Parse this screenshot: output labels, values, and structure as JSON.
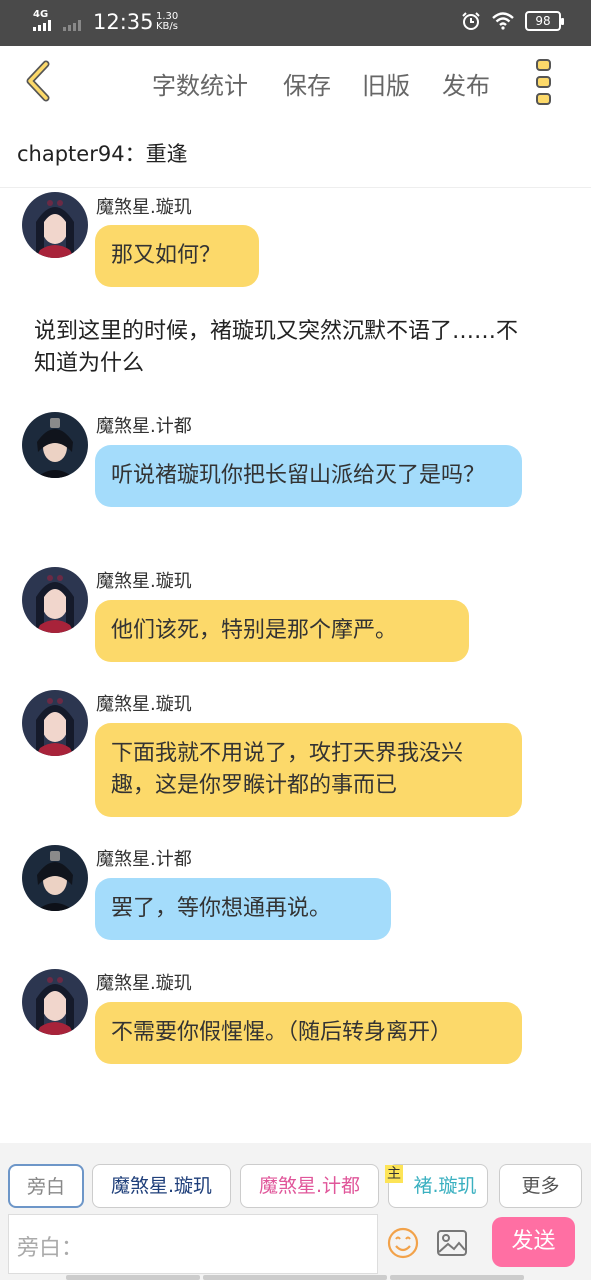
{
  "status_bar": {
    "network": "4G",
    "time": "12:35",
    "speed_value": "1.30",
    "speed_unit": "KB/s",
    "battery": "98"
  },
  "toolbar": {
    "word_count_label": "字数统计",
    "save_label": "保存",
    "old_version_label": "旧版",
    "publish_label": "发布"
  },
  "chapter_title": "chapter94：重逢",
  "messages": [
    {
      "speaker": "魔煞星.璇玑",
      "text": "那又如何？",
      "color": "#fcd96a"
    },
    {
      "speaker": "魔煞星.计都",
      "text": "听说褚璇玑你把长留山派给灭了是吗？",
      "color": "#a4dcfb"
    },
    {
      "speaker": "魔煞星.璇玑",
      "text": "他们该死，特别是那个摩严。",
      "color": "#fcd96a"
    },
    {
      "speaker": "魔煞星.璇玑",
      "text": "下面我就不用说了，攻打天界我没兴趣，这是你罗睺计都的事而已",
      "color": "#fcd96a"
    },
    {
      "speaker": "魔煞星.计都",
      "text": "罢了，等你想通再说。",
      "color": "#a4dcfb"
    },
    {
      "speaker": "魔煞星.璇玑",
      "text": "不需要你假惺惺。（随后转身离开）",
      "color": "#fcd96a"
    }
  ],
  "narration": "说到这里的时候，褚璇玑又突然沉默不语了……不知道为什么",
  "role_chips": [
    {
      "label": "旁白",
      "color": "#888888"
    },
    {
      "label": "魔煞星.璇玑",
      "color": "#1f3f7a"
    },
    {
      "label": "魔煞星.计都",
      "color": "#e0569a"
    },
    {
      "label": "褚.璇玑",
      "color": "#3ab0c0"
    },
    {
      "label": "更多",
      "color": "#555555"
    }
  ],
  "main_badge": "主",
  "input": {
    "placeholder": "旁白："
  },
  "send_label": "发送"
}
